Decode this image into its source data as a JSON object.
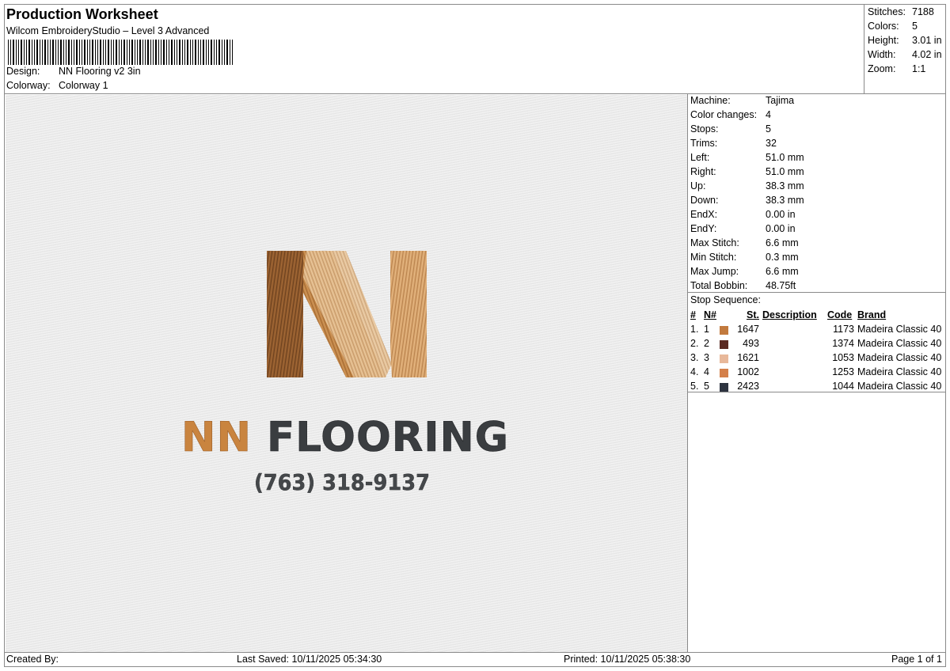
{
  "header": {
    "title": "Production Worksheet",
    "subtitle": "Wilcom EmbroideryStudio – Level 3 Advanced",
    "design_label": "Design:",
    "design_value": "NN Flooring v2 3in",
    "colorway_label": "Colorway:",
    "colorway_value": "Colorway 1"
  },
  "summary": [
    {
      "label": "Stitches:",
      "value": "7188"
    },
    {
      "label": "Colors:",
      "value": "5"
    },
    {
      "label": "Height:",
      "value": "3.01 in"
    },
    {
      "label": "Width:",
      "value": "4.02 in"
    },
    {
      "label": "Zoom:",
      "value": "1:1"
    }
  ],
  "machine": [
    {
      "label": "Machine:",
      "value": "Tajima"
    },
    {
      "label": "Color changes:",
      "value": "4"
    },
    {
      "label": "Stops:",
      "value": "5"
    },
    {
      "label": "Trims:",
      "value": "32"
    },
    {
      "label": "Left:",
      "value": "51.0 mm"
    },
    {
      "label": "Right:",
      "value": "51.0 mm"
    },
    {
      "label": "Up:",
      "value": "38.3 mm"
    },
    {
      "label": "Down:",
      "value": "38.3 mm"
    },
    {
      "label": "EndX:",
      "value": "0.00 in"
    },
    {
      "label": "EndY:",
      "value": "0.00 in"
    },
    {
      "label": "Max Stitch:",
      "value": "6.6 mm"
    },
    {
      "label": "Min Stitch:",
      "value": "0.3 mm"
    },
    {
      "label": "Max Jump:",
      "value": "6.6 mm"
    },
    {
      "label": "Total Bobbin:",
      "value": "48.75ft"
    }
  ],
  "stop_sequence": {
    "label": "Stop Sequence:",
    "headers": {
      "num": "#",
      "n": "N#",
      "st": "St.",
      "desc": "Description",
      "code": "Code",
      "brand": "Brand"
    },
    "rows": [
      {
        "num": "1.",
        "n": "1",
        "color": "#c27a3e",
        "st": "1647",
        "desc": "",
        "code": "1173",
        "brand": "Madeira Classic 40"
      },
      {
        "num": "2.",
        "n": "2",
        "color": "#5a2a22",
        "st": "493",
        "desc": "",
        "code": "1374",
        "brand": "Madeira Classic 40"
      },
      {
        "num": "3.",
        "n": "3",
        "color": "#e8b89a",
        "st": "1621",
        "desc": "",
        "code": "1053",
        "brand": "Madeira Classic 40"
      },
      {
        "num": "4.",
        "n": "4",
        "color": "#d4804a",
        "st": "1002",
        "desc": "",
        "code": "1253",
        "brand": "Madeira Classic 40"
      },
      {
        "num": "5.",
        "n": "5",
        "color": "#2e3440",
        "st": "2423",
        "desc": "",
        "code": "1044",
        "brand": "Madeira Classic 40"
      }
    ]
  },
  "design": {
    "logo_word_1": "NN",
    "logo_word_2": "FLOORING",
    "phone": "(763) 318-9137",
    "color_orange": "#c9843f",
    "color_dark": "#3a3d40"
  },
  "footer": {
    "created_by": "Created By:",
    "last_saved": "Last Saved: 10/11/2025 05:34:30",
    "printed": "Printed: 10/11/2025 05:38:30",
    "page": "Page 1 of 1"
  }
}
